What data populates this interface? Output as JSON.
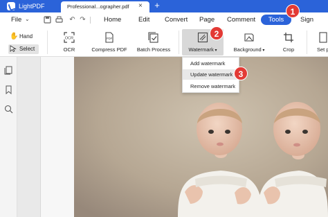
{
  "window": {
    "app_name": "LightPDF",
    "doc_tab_name": "Professional...ographer.pdf",
    "close_glyph": "×",
    "new_tab_glyph": "+",
    "accent_color": "#2b63d9"
  },
  "menubar": {
    "file_label": "File",
    "items": [
      "Home",
      "Edit",
      "Convert",
      "Page",
      "Comment",
      "Tools",
      "Sign"
    ],
    "active": "Tools"
  },
  "toolbar": {
    "hand_label": "Hand",
    "select_label": "Select",
    "ocr_label": "OCR",
    "compress_label": "Compress PDF",
    "batch_label": "Batch Process",
    "watermark_label": "Watermark",
    "background_label": "Background",
    "crop_label": "Crop",
    "set_label": "Set p"
  },
  "watermark_menu": {
    "items": [
      "Add watermark",
      "Update watermark",
      "Remove watermark"
    ],
    "highlighted": "Update watermark"
  },
  "annotations": {
    "badge1": "1",
    "badge2": "2",
    "badge3": "3",
    "badge_color": "#e33a35"
  },
  "sidebar": {
    "icons": [
      "pages-icon",
      "bookmark-icon",
      "search-icon"
    ]
  }
}
